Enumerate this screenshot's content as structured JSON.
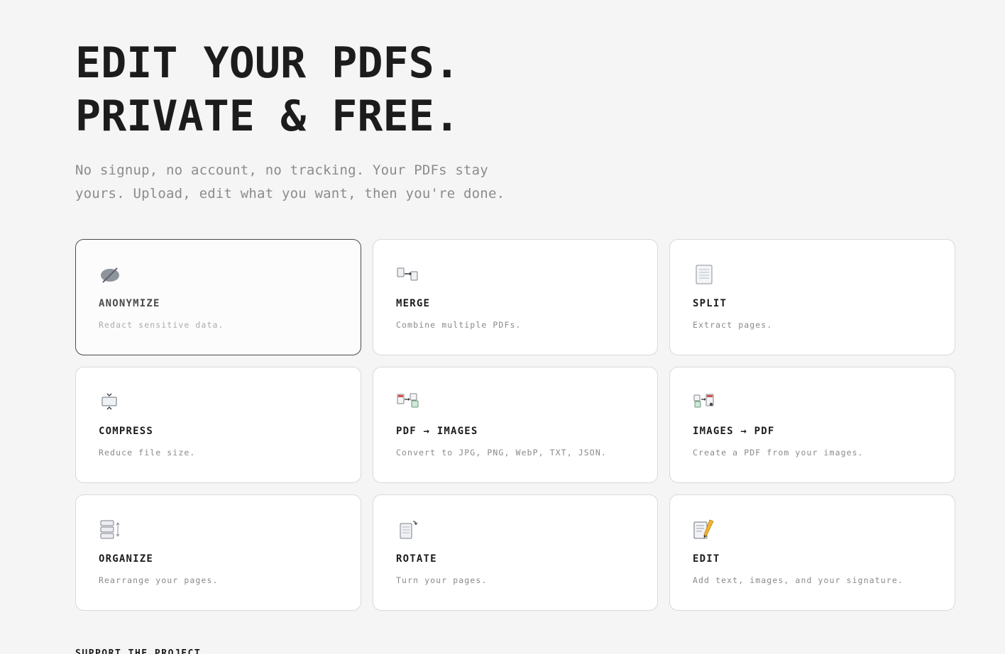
{
  "hero": {
    "title_line1": "EDIT YOUR PDFS.",
    "title_line2": "PRIVATE & FREE.",
    "subtitle": "No signup, no account, no tracking. Your PDFs stay yours. Upload, edit what you want, then you're done."
  },
  "tools": [
    {
      "label": "ANONYMIZE",
      "description": "Redact sensitive data.",
      "icon": "anonymize-icon"
    },
    {
      "label": "MERGE",
      "description": "Combine multiple PDFs.",
      "icon": "merge-icon"
    },
    {
      "label": "SPLIT",
      "description": "Extract pages.",
      "icon": "split-icon"
    },
    {
      "label": "COMPRESS",
      "description": "Reduce file size.",
      "icon": "compress-icon"
    },
    {
      "label": "PDF → IMAGES",
      "description": "Convert to JPG, PNG, WebP, TXT, JSON.",
      "icon": "pdf-to-images-icon"
    },
    {
      "label": "IMAGES → PDF",
      "description": "Create a PDF from your images.",
      "icon": "images-to-pdf-icon"
    },
    {
      "label": "ORGANIZE",
      "description": "Rearrange your pages.",
      "icon": "organize-icon"
    },
    {
      "label": "ROTATE",
      "description": "Turn your pages.",
      "icon": "rotate-icon"
    },
    {
      "label": "EDIT",
      "description": "Add text, images, and your signature.",
      "icon": "edit-icon"
    }
  ],
  "footer": {
    "heading": "SUPPORT THE PROJECT"
  },
  "colors": {
    "background": "#f5f5f5",
    "card": "#ffffff",
    "text": "#1c1c1c",
    "muted": "#8a8a8a"
  }
}
